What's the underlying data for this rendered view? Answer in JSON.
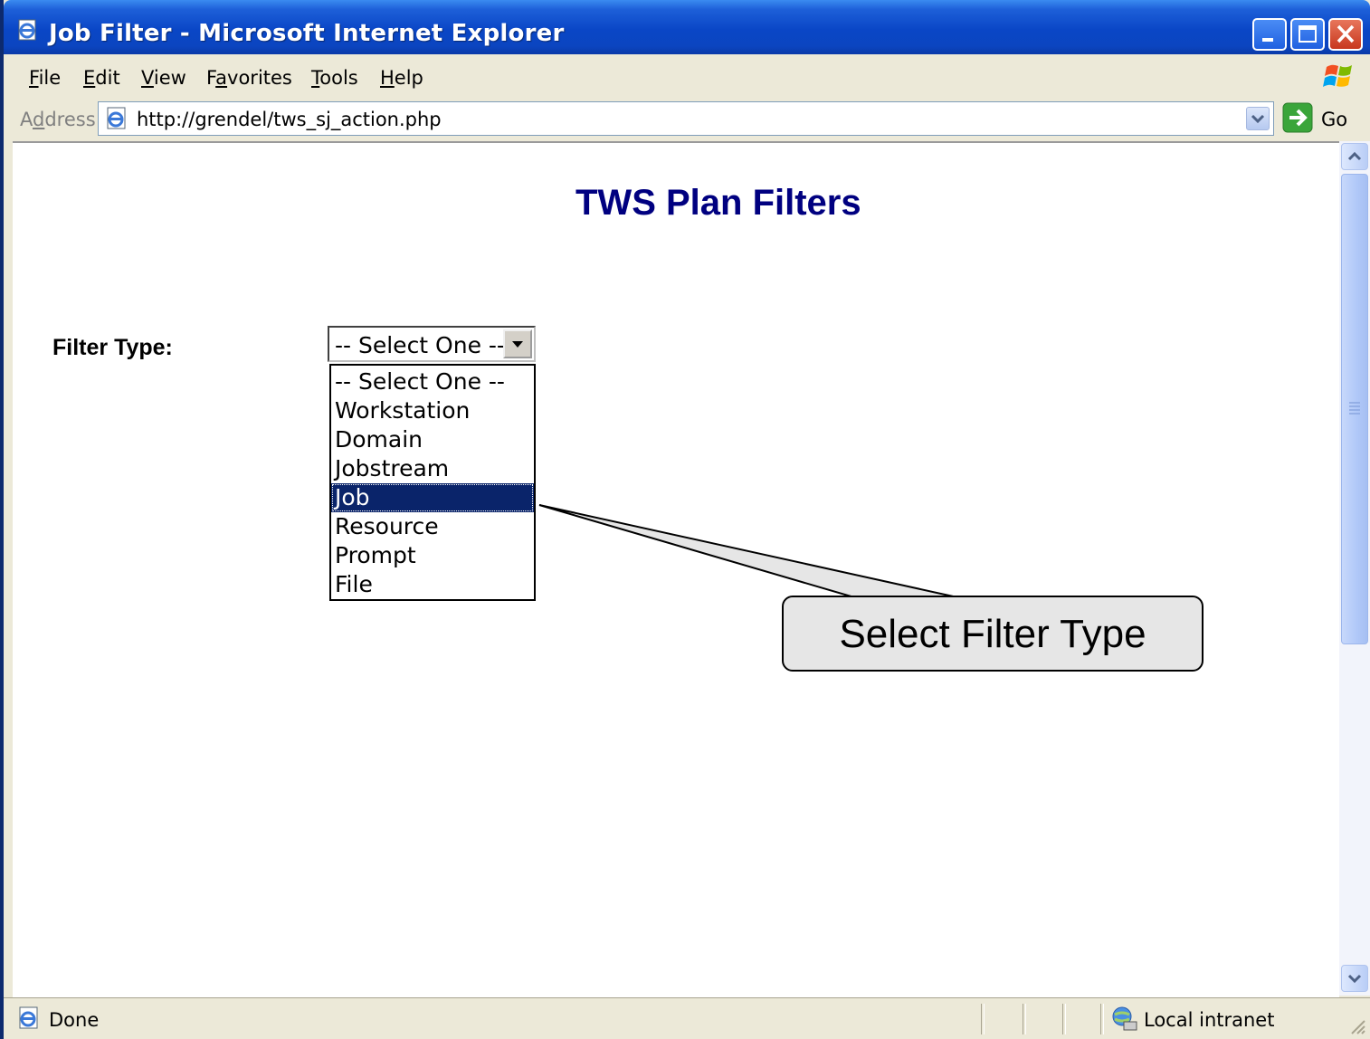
{
  "window": {
    "title": "Job Filter - Microsoft Internet Explorer"
  },
  "menubar": {
    "items": [
      {
        "label": "File",
        "accel": "F",
        "rest": "ile"
      },
      {
        "label": "Edit",
        "accel": "E",
        "rest": "dit"
      },
      {
        "label": "View",
        "accel": "V",
        "rest": "iew"
      },
      {
        "label": "Favorites",
        "pre": "F",
        "accel": "a",
        "rest": "vorites"
      },
      {
        "label": "Tools",
        "accel": "T",
        "rest": "ools"
      },
      {
        "label": "Help",
        "accel": "H",
        "rest": "elp"
      }
    ]
  },
  "addressbar": {
    "label_pre": "A",
    "label_accel": "d",
    "label_rest": "dress",
    "url": "http://grendel/tws_sj_action.php",
    "go_label": "Go"
  },
  "page": {
    "title": "TWS Plan Filters",
    "filter_label": "Filter Type:",
    "select_value": "-- Select One --",
    "options": [
      "-- Select One --",
      "Workstation",
      "Domain",
      "Jobstream",
      "Job",
      "Resource",
      "Prompt",
      "File"
    ],
    "highlighted_option": "Job"
  },
  "callout": {
    "text": "Select Filter Type"
  },
  "statusbar": {
    "status": "Done",
    "zone": "Local intranet"
  },
  "icons": {
    "title": "ie-page-icon",
    "address": "ie-page-icon",
    "go": "go-arrow-icon",
    "status": "ie-page-icon",
    "zone": "local-intranet-icon",
    "brand": "windows-flag-icon"
  },
  "colors": {
    "title_bar": "#0a46c6",
    "page_title": "#000080",
    "selection": "#0a246a",
    "callout_fill": "#e6e6e6"
  }
}
